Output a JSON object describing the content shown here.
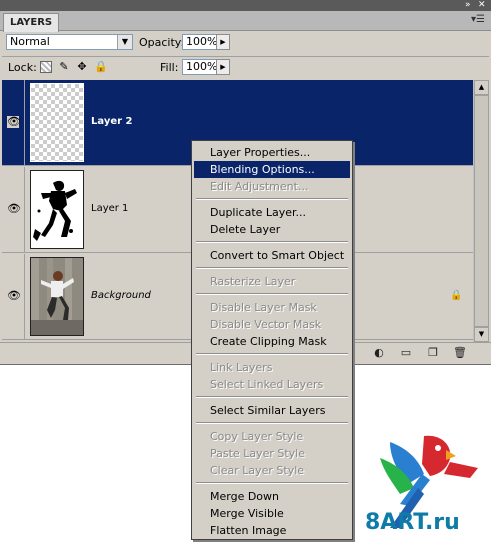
{
  "panel": {
    "tab_label": "LAYERS",
    "menu_icon": "menu-icon",
    "title_controls": [
      "collapse-icon",
      "close-icon"
    ]
  },
  "options": {
    "blend_mode": "Normal",
    "opacity_label": "Opacity:",
    "opacity_value": "100%",
    "lock_label": "Lock:",
    "fill_label": "Fill:",
    "fill_value": "100%",
    "lock_icons": [
      "lock-transparent-pixels-icon",
      "lock-image-pixels-icon",
      "lock-position-icon",
      "lock-all-icon"
    ]
  },
  "layers": [
    {
      "name": "Layer 2",
      "selected": true,
      "thumbnail": "transparent"
    },
    {
      "name": "Layer 1",
      "selected": false,
      "thumbnail": "silhouette"
    },
    {
      "name": "Background",
      "selected": false,
      "thumbnail": "photo",
      "locked": true
    }
  ],
  "bottom_toolbar_icons": [
    "link-layers-icon",
    "add-style-icon",
    "add-mask-icon",
    "adjustment-layer-icon",
    "new-group-icon",
    "new-layer-icon",
    "delete-layer-icon"
  ],
  "context_menu": {
    "items": [
      {
        "label": "Layer Properties...",
        "enabled": true
      },
      {
        "label": "Blending Options...",
        "enabled": true,
        "highlighted": true
      },
      {
        "label": "Edit Adjustment...",
        "enabled": false
      },
      {
        "separator": true
      },
      {
        "label": "Duplicate Layer...",
        "enabled": true
      },
      {
        "label": "Delete Layer",
        "enabled": true
      },
      {
        "separator": true
      },
      {
        "label": "Convert to Smart Object",
        "enabled": true
      },
      {
        "separator": true
      },
      {
        "label": "Rasterize Layer",
        "enabled": false
      },
      {
        "separator": true
      },
      {
        "label": "Disable Layer Mask",
        "enabled": false
      },
      {
        "label": "Disable Vector Mask",
        "enabled": false
      },
      {
        "label": "Create Clipping Mask",
        "enabled": true
      },
      {
        "separator": true
      },
      {
        "label": "Link Layers",
        "enabled": false
      },
      {
        "label": "Select Linked Layers",
        "enabled": false
      },
      {
        "separator": true
      },
      {
        "label": "Select Similar Layers",
        "enabled": true
      },
      {
        "separator": true
      },
      {
        "label": "Copy Layer Style",
        "enabled": false
      },
      {
        "label": "Paste Layer Style",
        "enabled": false
      },
      {
        "label": "Clear Layer Style",
        "enabled": false
      },
      {
        "separator": true
      },
      {
        "label": "Merge Down",
        "enabled": true
      },
      {
        "label": "Merge Visible",
        "enabled": true
      },
      {
        "label": "Flatten Image",
        "enabled": true
      }
    ]
  },
  "watermark": {
    "text": "8ART.ru",
    "colors": {
      "text": "#0f7ca8",
      "parrot_red": "#d6282f",
      "parrot_blue": "#2a7fd0",
      "parrot_green": "#27b34a"
    }
  },
  "colors": {
    "selection": "#0a246a",
    "panel_bg": "#d4d0c8"
  }
}
